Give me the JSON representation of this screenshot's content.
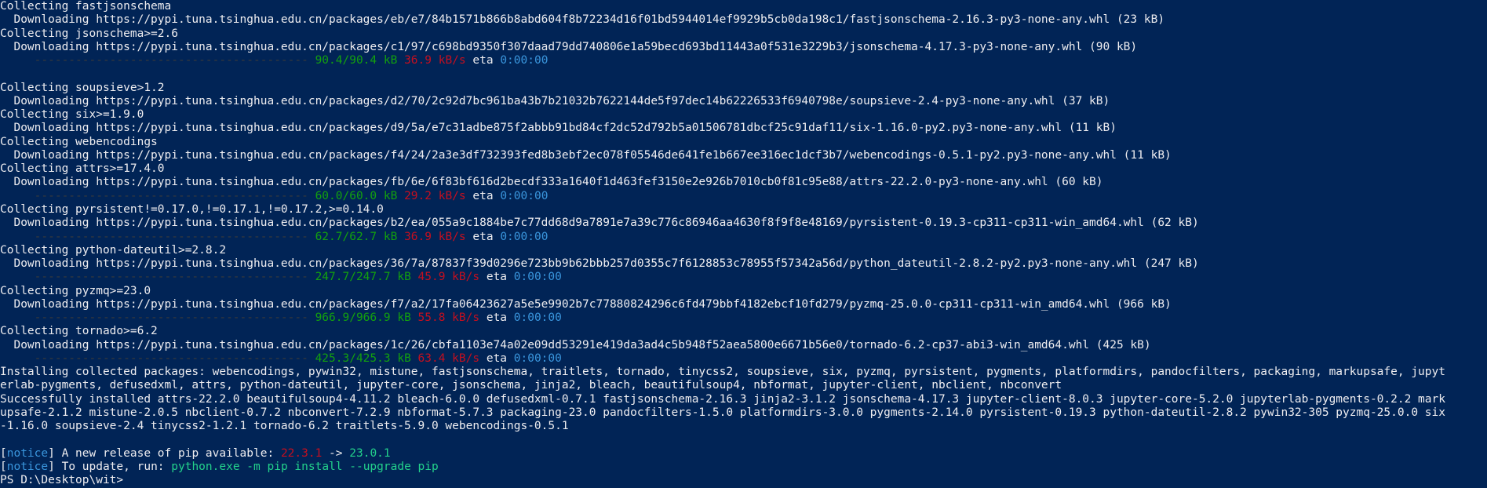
{
  "terminal": {
    "lines": [
      [
        {
          "t": "Collecting fastjsonschema",
          "c": "fg"
        }
      ],
      [
        {
          "t": "  Downloading https://pypi.tuna.tsinghua.edu.cn/packages/eb/e7/84b1571b866b8abd604f8b72234d16f01bd5944014ef9929b5cb0da198c1/fastjsonschema-2.16.3-py3-none-any.whl (23 kB)",
          "c": "fg"
        }
      ],
      [
        {
          "t": "Collecting jsonschema>=2.6",
          "c": "fg"
        }
      ],
      [
        {
          "t": "  Downloading https://pypi.tuna.tsinghua.edu.cn/packages/c1/97/c698bd9350f307daad79dd740806e1a59becd693bd11443a0f531e3229b3/jsonschema-4.17.3-py3-none-any.whl (90 kB)",
          "c": "fg"
        }
      ],
      [
        {
          "t": "     ---------------------------------------- ",
          "c": "bar"
        },
        {
          "t": "90.4/90.4 kB",
          "c": "green"
        },
        {
          "t": " ",
          "c": "fg"
        },
        {
          "t": "36.9 kB/s",
          "c": "red"
        },
        {
          "t": " eta ",
          "c": "fg"
        },
        {
          "t": "0:00:00",
          "c": "cyan"
        }
      ],
      [
        {
          "t": "",
          "c": "fg"
        }
      ],
      [
        {
          "t": "Collecting soupsieve>1.2",
          "c": "fg"
        }
      ],
      [
        {
          "t": "  Downloading https://pypi.tuna.tsinghua.edu.cn/packages/d2/70/2c92d7bc961ba43b7b21032b7622144de5f97dec14b62226533f6940798e/soupsieve-2.4-py3-none-any.whl (37 kB)",
          "c": "fg"
        }
      ],
      [
        {
          "t": "Collecting six>=1.9.0",
          "c": "fg"
        }
      ],
      [
        {
          "t": "  Downloading https://pypi.tuna.tsinghua.edu.cn/packages/d9/5a/e7c31adbe875f2abbb91bd84cf2dc52d792b5a01506781dbcf25c91daf11/six-1.16.0-py2.py3-none-any.whl (11 kB)",
          "c": "fg"
        }
      ],
      [
        {
          "t": "Collecting webencodings",
          "c": "fg"
        }
      ],
      [
        {
          "t": "  Downloading https://pypi.tuna.tsinghua.edu.cn/packages/f4/24/2a3e3df732393fed8b3ebf2ec078f05546de641fe1b667ee316ec1dcf3b7/webencodings-0.5.1-py2.py3-none-any.whl (11 kB)",
          "c": "fg"
        }
      ],
      [
        {
          "t": "Collecting attrs>=17.4.0",
          "c": "fg"
        }
      ],
      [
        {
          "t": "  Downloading https://pypi.tuna.tsinghua.edu.cn/packages/fb/6e/6f83bf616d2becdf333a1640f1d463fef3150e2e926b7010cb0f81c95e88/attrs-22.2.0-py3-none-any.whl (60 kB)",
          "c": "fg"
        }
      ],
      [
        {
          "t": "     ---------------------------------------- ",
          "c": "bar"
        },
        {
          "t": "60.0/60.0 kB",
          "c": "green"
        },
        {
          "t": " ",
          "c": "fg"
        },
        {
          "t": "29.2 kB/s",
          "c": "red"
        },
        {
          "t": " eta ",
          "c": "fg"
        },
        {
          "t": "0:00:00",
          "c": "cyan"
        }
      ],
      [
        {
          "t": "Collecting pyrsistent!=0.17.0,!=0.17.1,!=0.17.2,>=0.14.0",
          "c": "fg"
        }
      ],
      [
        {
          "t": "  Downloading https://pypi.tuna.tsinghua.edu.cn/packages/b2/ea/055a9c1884be7c77dd68d9a7891e7a39c776c86946aa4630f8f9f8e48169/pyrsistent-0.19.3-cp311-cp311-win_amd64.whl (62 kB)",
          "c": "fg"
        }
      ],
      [
        {
          "t": "     ---------------------------------------- ",
          "c": "bar"
        },
        {
          "t": "62.7/62.7 kB",
          "c": "green"
        },
        {
          "t": " ",
          "c": "fg"
        },
        {
          "t": "36.9 kB/s",
          "c": "red"
        },
        {
          "t": " eta ",
          "c": "fg"
        },
        {
          "t": "0:00:00",
          "c": "cyan"
        }
      ],
      [
        {
          "t": "Collecting python-dateutil>=2.8.2",
          "c": "fg"
        }
      ],
      [
        {
          "t": "  Downloading https://pypi.tuna.tsinghua.edu.cn/packages/36/7a/87837f39d0296e723bb9b62bbb257d0355c7f6128853c78955f57342a56d/python_dateutil-2.8.2-py2.py3-none-any.whl (247 kB)",
          "c": "fg"
        }
      ],
      [
        {
          "t": "     ---------------------------------------- ",
          "c": "bar"
        },
        {
          "t": "247.7/247.7 kB",
          "c": "green"
        },
        {
          "t": " ",
          "c": "fg"
        },
        {
          "t": "45.9 kB/s",
          "c": "red"
        },
        {
          "t": " eta ",
          "c": "fg"
        },
        {
          "t": "0:00:00",
          "c": "cyan"
        }
      ],
      [
        {
          "t": "Collecting pyzmq>=23.0",
          "c": "fg"
        }
      ],
      [
        {
          "t": "  Downloading https://pypi.tuna.tsinghua.edu.cn/packages/f7/a2/17fa06423627a5e5e9902b7c77880824296c6fd479bbf4182ebcf10fd279/pyzmq-25.0.0-cp311-cp311-win_amd64.whl (966 kB)",
          "c": "fg"
        }
      ],
      [
        {
          "t": "     ---------------------------------------- ",
          "c": "bar"
        },
        {
          "t": "966.9/966.9 kB",
          "c": "green"
        },
        {
          "t": " ",
          "c": "fg"
        },
        {
          "t": "55.8 kB/s",
          "c": "red"
        },
        {
          "t": " eta ",
          "c": "fg"
        },
        {
          "t": "0:00:00",
          "c": "cyan"
        }
      ],
      [
        {
          "t": "Collecting tornado>=6.2",
          "c": "fg"
        }
      ],
      [
        {
          "t": "  Downloading https://pypi.tuna.tsinghua.edu.cn/packages/1c/26/cbfa1103e74a02e09dd53291e419da3ad4c5b948f52aea5800e6671b56e0/tornado-6.2-cp37-abi3-win_amd64.whl (425 kB)",
          "c": "fg"
        }
      ],
      [
        {
          "t": "     ---------------------------------------- ",
          "c": "bar"
        },
        {
          "t": "425.3/425.3 kB",
          "c": "green"
        },
        {
          "t": " ",
          "c": "fg"
        },
        {
          "t": "63.4 kB/s",
          "c": "red"
        },
        {
          "t": " eta ",
          "c": "fg"
        },
        {
          "t": "0:00:00",
          "c": "cyan"
        }
      ],
      [
        {
          "t": "Installing collected packages: webencodings, pywin32, mistune, fastjsonschema, traitlets, tornado, tinycss2, soupsieve, six, pyzmq, pyrsistent, pygments, platformdirs, pandocfilters, packaging, markupsafe, jupyt",
          "c": "fg"
        }
      ],
      [
        {
          "t": "erlab-pygments, defusedxml, attrs, python-dateutil, jupyter-core, jsonschema, jinja2, bleach, beautifulsoup4, nbformat, jupyter-client, nbclient, nbconvert",
          "c": "fg"
        }
      ],
      [
        {
          "t": "Successfully installed attrs-22.2.0 beautifulsoup4-4.11.2 bleach-6.0.0 defusedxml-0.7.1 fastjsonschema-2.16.3 jinja2-3.1.2 jsonschema-4.17.3 jupyter-client-8.0.3 jupyter-core-5.2.0 jupyterlab-pygments-0.2.2 mark",
          "c": "fg"
        }
      ],
      [
        {
          "t": "upsafe-2.1.2 mistune-2.0.5 nbclient-0.7.2 nbconvert-7.2.9 nbformat-5.7.3 packaging-23.0 pandocfilters-1.5.0 platformdirs-3.0.0 pygments-2.14.0 pyrsistent-0.19.3 python-dateutil-2.8.2 pywin32-305 pyzmq-25.0.0 six",
          "c": "fg"
        }
      ],
      [
        {
          "t": "-1.16.0 soupsieve-2.4 tinycss2-1.2.1 tornado-6.2 traitlets-5.9.0 webencodings-0.5.1",
          "c": "fg"
        }
      ],
      [
        {
          "t": "",
          "c": "fg"
        }
      ],
      [
        {
          "t": "[",
          "c": "fg"
        },
        {
          "t": "notice",
          "c": "notice"
        },
        {
          "t": "] A new release of pip available: ",
          "c": "fg"
        },
        {
          "t": "22.3.1",
          "c": "red"
        },
        {
          "t": " -> ",
          "c": "fg"
        },
        {
          "t": "23.0.1",
          "c": "green2"
        }
      ],
      [
        {
          "t": "[",
          "c": "fg"
        },
        {
          "t": "notice",
          "c": "notice"
        },
        {
          "t": "] To update, run: ",
          "c": "fg"
        },
        {
          "t": "python.exe -m pip install --upgrade pip",
          "c": "green2"
        }
      ],
      [
        {
          "t": "PS D:\\Desktop\\wit> ",
          "c": "fg"
        }
      ]
    ]
  }
}
